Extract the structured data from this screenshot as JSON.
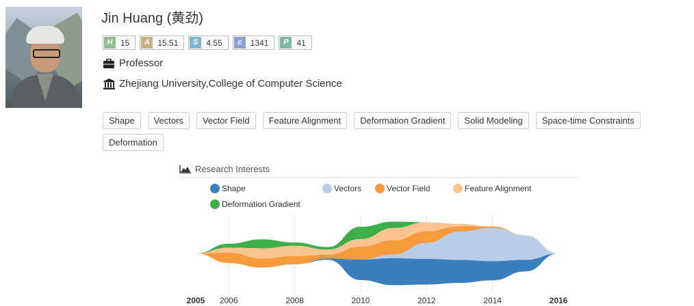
{
  "profile": {
    "name": "Jin Huang (黄劲)",
    "metrics": [
      {
        "key": "H",
        "value": "15",
        "color": "#8fbf8f"
      },
      {
        "key": "A",
        "value": "15.51",
        "color": "#c9b27c"
      },
      {
        "key": "S",
        "value": "4.55",
        "color": "#7fb3d5"
      },
      {
        "key": "c",
        "value": "1341",
        "color": "#8f9fd8"
      },
      {
        "key": "P",
        "value": "41",
        "color": "#80b7a7"
      }
    ],
    "position": "Professor",
    "position_icon": "briefcase-icon",
    "affiliation": "Zhejiang University,College of Computer Science",
    "affiliation_icon": "institution-icon"
  },
  "tags": [
    "Shape",
    "Vectors",
    "Vector Field",
    "Feature Alignment",
    "Deformation Gradient",
    "Solid Modeling",
    "Space-time Constraints",
    "Deformation"
  ],
  "research": {
    "title": "Research Interests",
    "title_icon": "area-chart-icon"
  },
  "chart_data": {
    "type": "area",
    "subtype": "streamgraph",
    "x": [
      2005,
      2006,
      2007,
      2008,
      2009,
      2010,
      2011,
      2012,
      2013,
      2014,
      2015,
      2016
    ],
    "series": [
      {
        "name": "Shape",
        "color": "#3a7fbd",
        "values": [
          0,
          0,
          0,
          0,
          0.2,
          3.2,
          4.2,
          4.0,
          3.6,
          3.0,
          1.8,
          0
        ]
      },
      {
        "name": "Vectors",
        "color": "#b9cde9",
        "values": [
          0,
          0,
          0,
          0,
          0,
          0,
          0.6,
          2.5,
          4.4,
          5.2,
          3.8,
          0
        ]
      },
      {
        "name": "Vector Field",
        "color": "#f79a3c",
        "values": [
          0,
          1.6,
          1.4,
          1.3,
          0.6,
          2.0,
          2.2,
          1.8,
          0.8,
          0.2,
          0,
          0
        ]
      },
      {
        "name": "Feature Alignment",
        "color": "#f9c48f",
        "values": [
          0,
          0.8,
          1.6,
          1.6,
          0.8,
          1.2,
          1.9,
          1.4,
          0.4,
          0,
          0,
          0
        ]
      },
      {
        "name": "Deformation Gradient",
        "color": "#3caf4a",
        "values": [
          0,
          0.6,
          1.4,
          0.5,
          0.4,
          1.9,
          1.0,
          0,
          0,
          0,
          0,
          0
        ]
      }
    ],
    "x_ticks": [
      "2005",
      "2006",
      "2008",
      "2010",
      "2012",
      "2014",
      "2016"
    ],
    "bold_ticks": [
      "2005",
      "2016"
    ],
    "grid": true,
    "legend_position": "top"
  }
}
